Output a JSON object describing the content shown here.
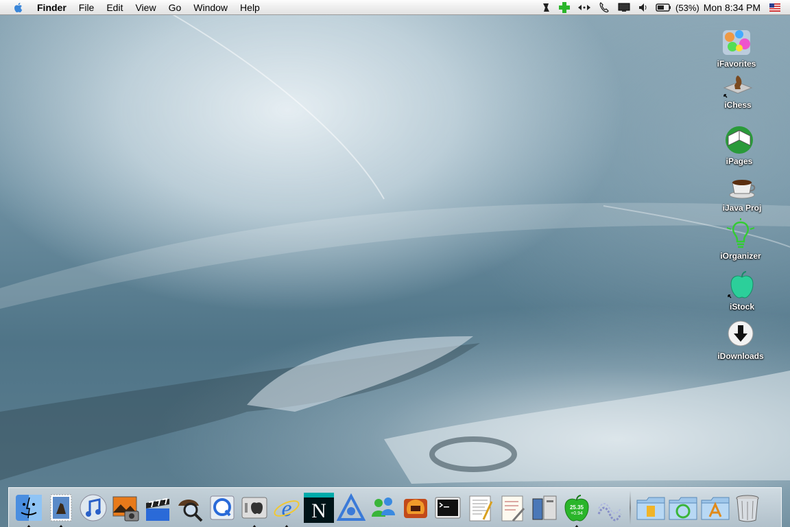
{
  "menubar": {
    "app_name": "Finder",
    "menus": [
      "File",
      "Edit",
      "View",
      "Go",
      "Window",
      "Help"
    ],
    "battery_percent": "(53%)",
    "clock": "Mon 8:34 PM",
    "extras": [
      "script-menu-icon",
      "add-icon",
      "network-arrows-icon",
      "phone-icon",
      "display-icon",
      "volume-icon",
      "battery-icon",
      "us-flag-icon"
    ]
  },
  "desktop": {
    "icons": [
      {
        "label": "iFavorites",
        "icon": "bubbles-icon"
      },
      {
        "label": "iChess",
        "icon": "chess-icon"
      },
      {
        "label": "iPages",
        "icon": "book-icon"
      },
      {
        "label": "iJava Proj",
        "icon": "coffee-cup-icon"
      },
      {
        "label": "iOrganizer",
        "icon": "lightbulb-icon"
      },
      {
        "label": "iStock",
        "icon": "apple-stock-icon"
      },
      {
        "label": "iDownloads",
        "icon": "download-arrow-icon"
      }
    ]
  },
  "dock": {
    "items": [
      {
        "name": "finder",
        "running": true
      },
      {
        "name": "mail",
        "running": true
      },
      {
        "name": "itunes",
        "running": false
      },
      {
        "name": "iphoto",
        "running": false
      },
      {
        "name": "imovie",
        "running": false
      },
      {
        "name": "sherlock",
        "running": false
      },
      {
        "name": "quicktime",
        "running": false
      },
      {
        "name": "system-preferences",
        "running": true
      },
      {
        "name": "internet-explorer",
        "running": true
      },
      {
        "name": "netscape",
        "running": false
      },
      {
        "name": "aol",
        "running": false
      },
      {
        "name": "msn-messenger",
        "running": false
      },
      {
        "name": "firewall",
        "running": false
      },
      {
        "name": "terminal",
        "running": false
      },
      {
        "name": "textedit",
        "running": false
      },
      {
        "name": "script-editor",
        "running": false
      },
      {
        "name": "disk-utility",
        "running": false
      },
      {
        "name": "stock-ticker",
        "running": true
      },
      {
        "name": "network-utility",
        "running": false
      }
    ],
    "stock_ticker_text": [
      "25.35",
      "+0.94"
    ],
    "netscape_letter": "N",
    "folders": [
      "documents-folder",
      "applications-folder",
      "utilities-folder"
    ],
    "trash": "trash"
  }
}
